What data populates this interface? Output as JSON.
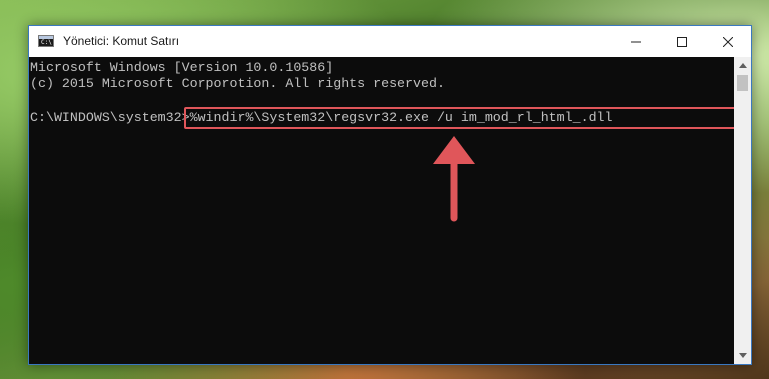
{
  "window": {
    "title": "Yönetici: Komut Satırı",
    "icon": "cmd-icon",
    "controls": {
      "minimize": "minimize-icon",
      "maximize": "maximize-icon",
      "close": "close-icon"
    }
  },
  "console": {
    "lines": [
      "Microsoft Windows [Version 10.0.10586]",
      "(c) 2015 Microsoft Corporotion. All rights reserved.",
      ""
    ],
    "prompt": "C:\\WINDOWS\\system32>",
    "command": "%windir%\\System32\\regsvr32.exe /u im_mod_rl_html_.dll"
  },
  "colors": {
    "console_bg": "#0c0c0c",
    "console_text": "#c0c0c0",
    "highlight": "#e0565a",
    "arrow": "#e0565a",
    "window_border": "#3a78c0"
  },
  "annotation": {
    "arrow": "up-arrow-icon"
  }
}
